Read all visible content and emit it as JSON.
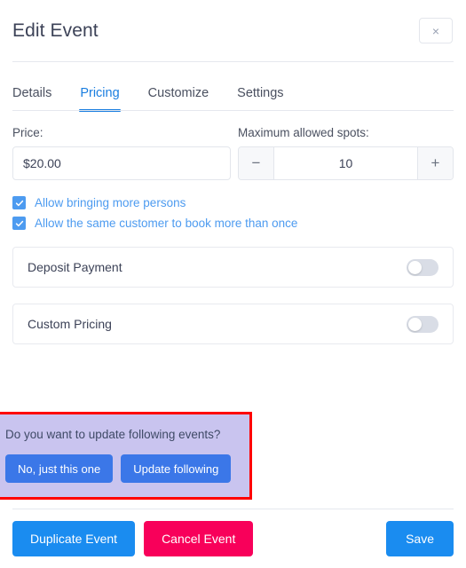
{
  "header": {
    "title": "Edit Event",
    "close_label": "×"
  },
  "tabs": [
    {
      "label": "Details",
      "active": false
    },
    {
      "label": "Pricing",
      "active": true
    },
    {
      "label": "Customize",
      "active": false
    },
    {
      "label": "Settings",
      "active": false
    }
  ],
  "pricing": {
    "price": {
      "label": "Price:",
      "value": "$20.00",
      "placeholder": "Price"
    },
    "spots": {
      "label": "Maximum allowed spots:",
      "value": "10",
      "decrement_label": "−",
      "increment_label": "+"
    },
    "checkboxes": [
      {
        "label": "Allow bringing more persons",
        "checked": true
      },
      {
        "label": "Allow the same customer to book more than once",
        "checked": true
      }
    ],
    "toggles": [
      {
        "label": "Deposit Payment",
        "enabled": false
      },
      {
        "label": "Custom Pricing",
        "enabled": false
      }
    ]
  },
  "update_prompt": {
    "question": "Do you want to update following events?",
    "buttons": [
      {
        "label": "No, just this one"
      },
      {
        "label": "Update following"
      }
    ]
  },
  "footer": {
    "duplicate_label": "Duplicate Event",
    "cancel_label": "Cancel Event",
    "save_label": "Save"
  },
  "colors": {
    "accent_blue": "#1a8cf0",
    "tab_active": "#1a7ee0",
    "checkbox_blue": "#4d9bf0",
    "cancel_pink": "#f8005a",
    "prompt_button_blue": "#3b77e8",
    "prompt_panel": "#c9c4ef",
    "highlight_border": "#ff0000",
    "toggle_off_track": "#d9dde6"
  }
}
